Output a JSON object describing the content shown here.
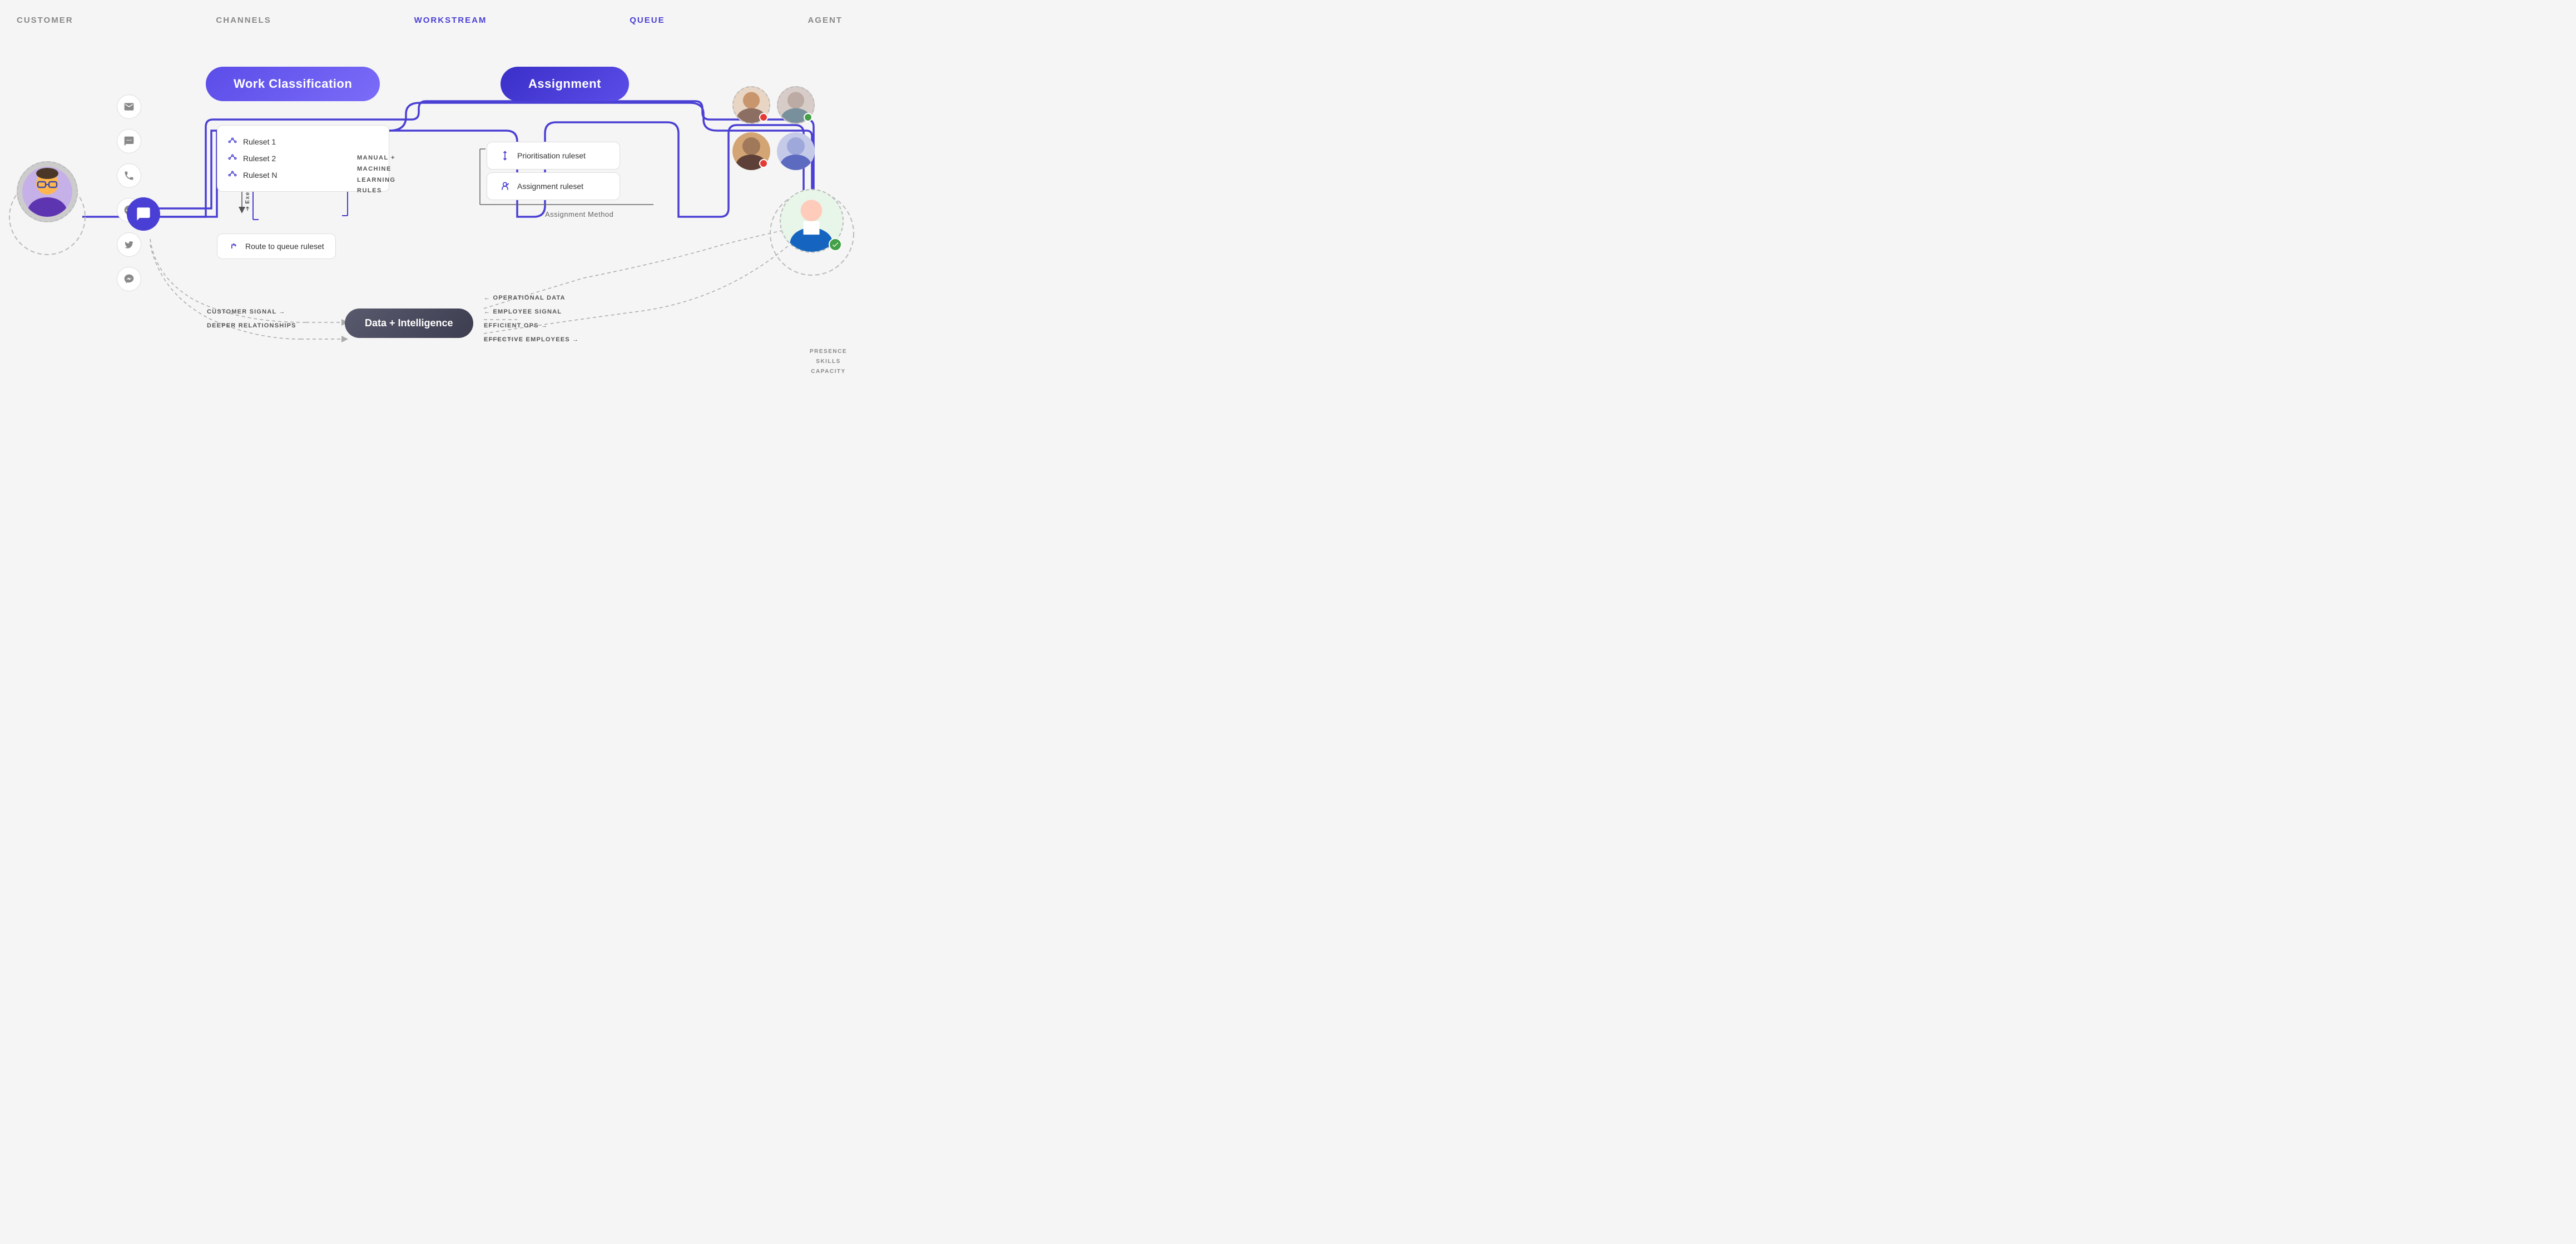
{
  "header": {
    "customer_label": "CUSTOMER",
    "channels_label": "CHANNELS",
    "workstream_label": "WORKSTREAM",
    "queue_label": "QUEUE",
    "agent_label": "AGENT"
  },
  "pills": {
    "work_classification": "Work Classification",
    "assignment": "Assignment"
  },
  "rulesets": {
    "items": [
      {
        "label": "Ruleset 1"
      },
      {
        "label": "Ruleset 2"
      },
      {
        "label": "Ruleset N"
      }
    ],
    "ml_label": "MANUAL +\nMACHINE\nLEARNING\nRULES",
    "execution_order": "Execution order",
    "route_label": "Route to queue ruleset"
  },
  "assignment": {
    "prioritisation_label": "Prioritisation ruleset",
    "assignment_ruleset_label": "Assignment ruleset",
    "method_label": "Assignment Method"
  },
  "data_intelligence": {
    "pill_label": "Data + Intelligence",
    "customer_signal": "CUSTOMER SIGNAL →",
    "deeper_relationships": "DEEPER RELATIONSHIPS",
    "operational_data": "← OPERATIONAL DATA",
    "employee_signal": "← EMPLOYEE SIGNAL",
    "efficient_ops": "EFFICIENT OPS →",
    "effective_employees": "EFFECTIVE EMPLOYEES →"
  },
  "agent": {
    "presence_label": "PRESENCE",
    "skills_label": "SKILLS",
    "capacity_label": "CAPACITY"
  },
  "colors": {
    "primary": "#4a3fd4",
    "pill_gradient_start": "#5b4de8",
    "pill_gradient_end": "#7b6cf8",
    "assignment_start": "#3a2fc8",
    "bg": "#f5f5f5"
  }
}
